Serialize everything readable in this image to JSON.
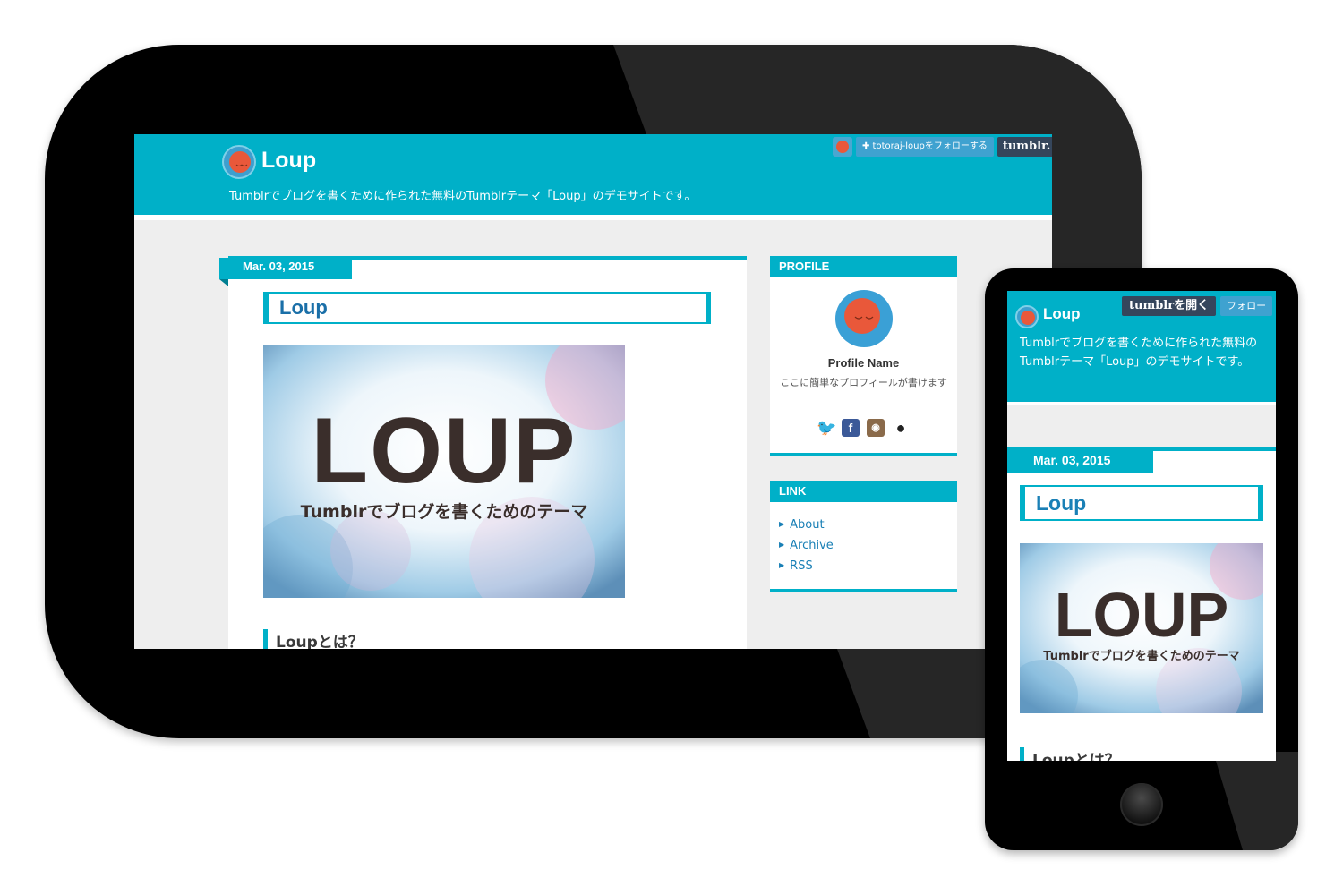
{
  "blog": {
    "title": "Loup",
    "description": "Tumblrでブログを書くために作られた無料のTumblrテーマ「Loup」のデモサイトです。",
    "description_mobile": "Tumblrでブログを書くために作られた無料のTumblrテーマ「Loup」のデモサイトです。"
  },
  "tumblr_controls": {
    "follow_label": "✚ totoraj-loupをフォローする",
    "tumblr_label": "tumblr.",
    "open_label": "tumblrを開く",
    "follow_short_label": "フォロー"
  },
  "post": {
    "date": "Mar. 03, 2015",
    "title": "Loup",
    "hero_logo": "LOUP",
    "hero_subtitle": "Tumblrでブログを書くためのテーマ",
    "section_heading": "Loupとは？"
  },
  "sidebar": {
    "profile_header": "PROFILE",
    "profile_name": "Profile Name",
    "profile_description": "ここに簡単なプロフィールが書けます",
    "social_icons": [
      "twitter-icon",
      "facebook-icon",
      "instagram-icon",
      "github-icon"
    ],
    "link_header": "LINK",
    "links": [
      "About",
      "Archive",
      "RSS"
    ]
  },
  "colors": {
    "accent": "#00b0c8",
    "link": "#1a80b6",
    "tumblr_dark": "#35465c",
    "avatar_face": "#e9583a"
  }
}
